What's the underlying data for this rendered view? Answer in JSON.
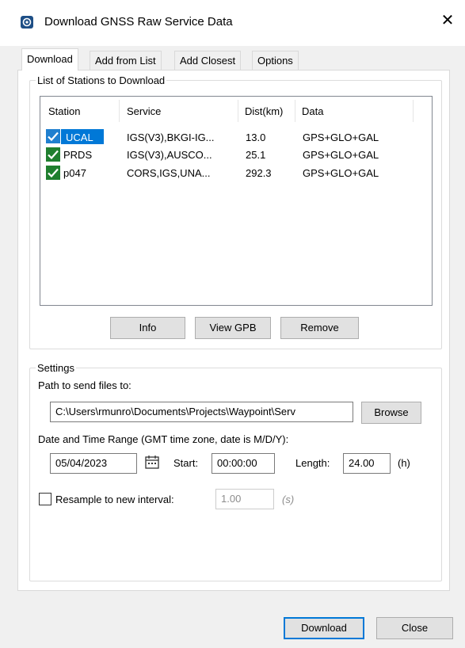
{
  "window": {
    "title": "Download GNSS Raw Service Data",
    "close_glyph": "✕",
    "app_icon": "gnss-app-icon"
  },
  "tabs": [
    {
      "label": "Download",
      "active": true
    },
    {
      "label": "Add from List",
      "active": false
    },
    {
      "label": "Add Closest",
      "active": false
    },
    {
      "label": "Options",
      "active": false
    }
  ],
  "stations_group": {
    "label": "List of Stations to Download",
    "columns": [
      "Station",
      "Service",
      "Dist(km)",
      "Data"
    ],
    "rows": [
      {
        "station": "UCAL",
        "service": "IGS(V3),BKGI-IG...",
        "dist": "13.0",
        "data": "GPS+GLO+GAL",
        "checked": true,
        "selected": true
      },
      {
        "station": "PRDS",
        "service": "IGS(V3),AUSCO...",
        "dist": "25.1",
        "data": "GPS+GLO+GAL",
        "checked": true,
        "selected": false
      },
      {
        "station": "p047",
        "service": "CORS,IGS,UNA...",
        "dist": "292.3",
        "data": "GPS+GLO+GAL",
        "checked": true,
        "selected": false
      }
    ],
    "buttons": {
      "info": "Info",
      "view_gpb": "View GPB",
      "remove": "Remove"
    }
  },
  "settings_group": {
    "label": "Settings",
    "path_label": "Path to send files to:",
    "path_value": "C:\\Users\\rmunro\\Documents\\Projects\\Waypoint\\Serv",
    "browse": "Browse",
    "range_label": "Date and Time Range (GMT time zone, date is M/D/Y):",
    "date_value": "05/04/2023",
    "calendar_icon": "calendar-icon",
    "start_label": "Start:",
    "start_value": "00:00:00",
    "length_label": "Length:",
    "length_value": "24.00",
    "length_unit": "(h)",
    "resample_label": "Resample to new interval:",
    "resample_checked": false,
    "resample_value": "1.00",
    "resample_unit": "(s)"
  },
  "footer": {
    "download": "Download",
    "close": "Close"
  },
  "colors": {
    "accent": "#0078d7",
    "check_green": "#1f7f2f",
    "dialog_bg": "#f0f0f0"
  }
}
